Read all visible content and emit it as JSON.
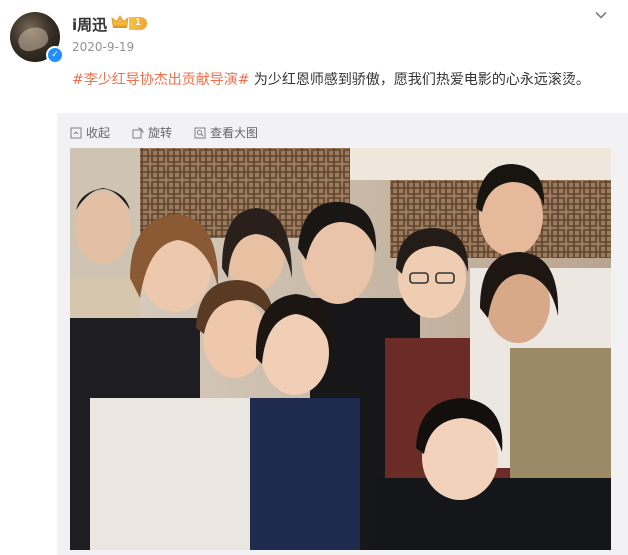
{
  "post": {
    "author": "i周迅",
    "vip_level": "1",
    "date": "2020-9-19",
    "hashtag": "#李少红导协杰出贡献导演#",
    "body_text": " 为少红恩师感到骄傲，愿我们热爱电影的心永远滚烫。"
  },
  "media_toolbar": {
    "collapse_label": "收起",
    "rotate_label": "旋转",
    "view_large_label": "查看大图"
  },
  "icons": {
    "menu": "chevron-down-icon",
    "verified": "verified-badge-icon",
    "vip": "crown-icon",
    "collapse": "collapse-icon",
    "rotate": "rotate-icon",
    "view_large": "zoom-icon"
  },
  "colors": {
    "hashtag": "#eb7350",
    "date": "#939393",
    "verified": "#1e90ff",
    "vip": "#f0a630"
  }
}
